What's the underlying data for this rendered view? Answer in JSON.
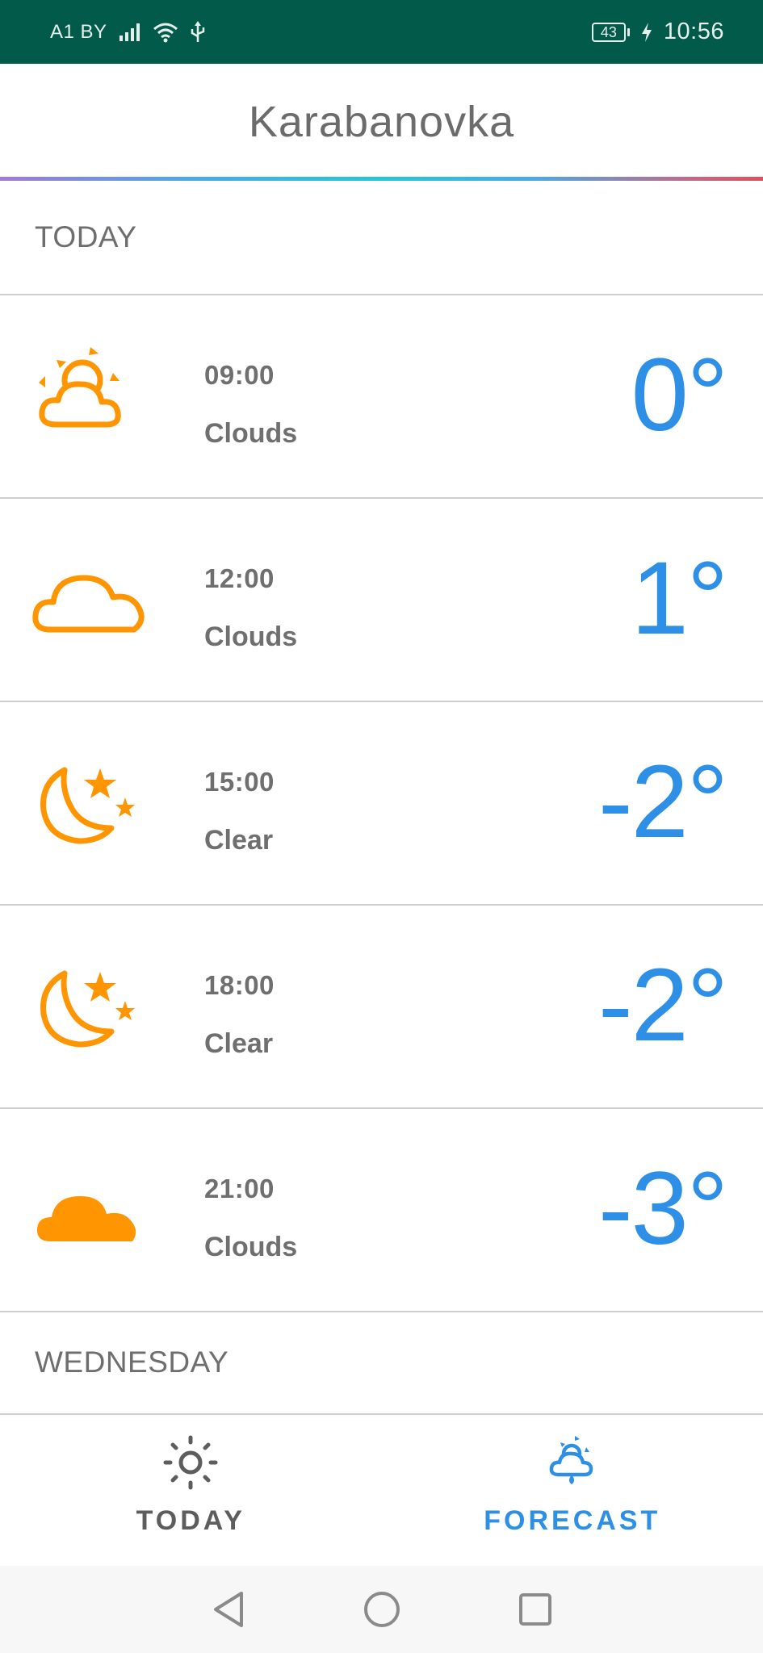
{
  "status_bar": {
    "carrier": "A1 BY",
    "battery": "43",
    "time": "10:56",
    "icons": [
      "signal-icon",
      "wifi-icon",
      "usb-icon",
      "battery-icon",
      "charging-icon"
    ]
  },
  "header": {
    "city": "Karabanovka"
  },
  "sections": {
    "today": "TODAY",
    "next": "WEDNESDAY"
  },
  "rows": [
    {
      "time": "09:00",
      "condition": "Clouds",
      "temp": "0°",
      "icon": "partly-cloudy-day-icon"
    },
    {
      "time": "12:00",
      "condition": "Clouds",
      "temp": "1°",
      "icon": "cloud-outline-icon"
    },
    {
      "time": "15:00",
      "condition": "Clear",
      "temp": "-2°",
      "icon": "moon-stars-icon"
    },
    {
      "time": "18:00",
      "condition": "Clear",
      "temp": "-2°",
      "icon": "moon-stars-icon"
    },
    {
      "time": "21:00",
      "condition": "Clouds",
      "temp": "-3°",
      "icon": "cloud-filled-icon"
    }
  ],
  "bottom_nav": {
    "today_label": "TODAY",
    "forecast_label": "FORECAST",
    "active": "forecast"
  },
  "colors": {
    "status_bar": "#025a4b",
    "icon_orange": "#ff9500",
    "temp_blue": "#2d8fe6",
    "text_gray": "#6f6f6f"
  }
}
